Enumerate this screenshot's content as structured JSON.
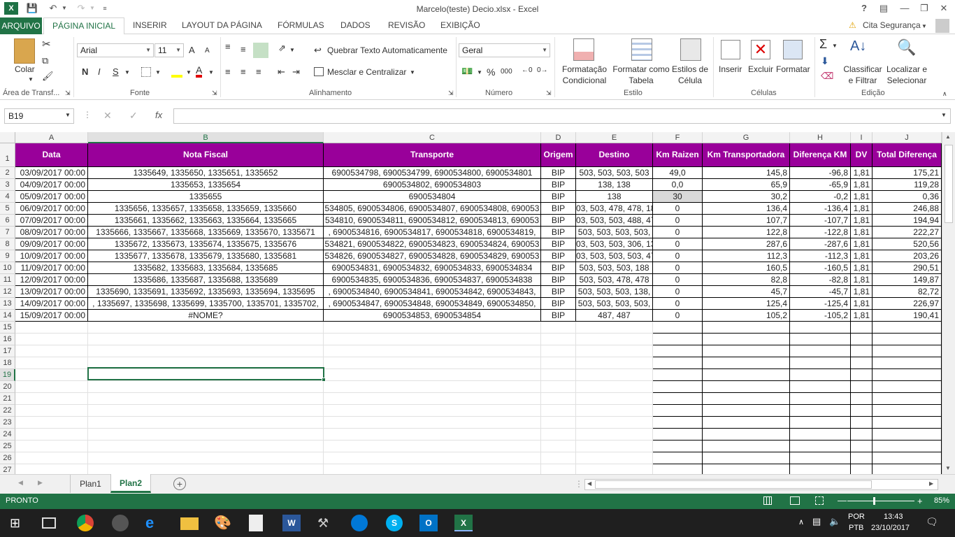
{
  "window": {
    "title": "Marcelo(teste) Decio.xlsx - Excel"
  },
  "ribbon_tabs": [
    {
      "label": "ARQUIVO"
    },
    {
      "label": "PÁGINA INICIAL"
    },
    {
      "label": "INSERIR"
    },
    {
      "label": "LAYOUT DA PÁGINA"
    },
    {
      "label": "FÓRMULAS"
    },
    {
      "label": "DADOS"
    },
    {
      "label": "REVISÃO"
    },
    {
      "label": "EXIBIÇÃO"
    }
  ],
  "account": {
    "label": "Cita Segurança"
  },
  "help": "?",
  "ribbon": {
    "clipboard": {
      "paste": "Colar",
      "group": "Área de Transf..."
    },
    "font": {
      "name": "Arial",
      "size": "11",
      "bold": "N",
      "italic": "I",
      "underline": "S",
      "grow": "A",
      "shrink": "A",
      "group": "Fonte"
    },
    "alignment": {
      "wrap": "Quebrar Texto Automaticamente",
      "merge": "Mesclar e Centralizar",
      "group": "Alinhamento"
    },
    "number": {
      "format": "Geral",
      "percent": "%",
      "thousands": "000",
      "group": "Número"
    },
    "styles": {
      "conditional": "Formatação Condicional",
      "table": "Formatar como Tabela",
      "cell": "Estilos de Célula",
      "group": "Estilo"
    },
    "cells": {
      "insert": "Inserir",
      "delete": "Excluir",
      "format": "Formatar",
      "group": "Células"
    },
    "editing": {
      "sort": "Classificar e Filtrar",
      "find": "Localizar e Selecionar",
      "group": "Edição"
    }
  },
  "formula_bar": {
    "name_box": "B19",
    "fx": "fx",
    "cancel": "✕",
    "enter": "✓"
  },
  "columns": [
    "A",
    "B",
    "C",
    "D",
    "E",
    "F",
    "G",
    "H",
    "I",
    "J"
  ],
  "header_row": [
    "Data",
    "Nota Fiscal",
    "Transporte",
    "Origem",
    "Destino",
    "Km Raizen",
    "Km Transportadora",
    "Diferença KM",
    "DV",
    "Total Diferença"
  ],
  "rows": [
    [
      "03/09/2017 00:00",
      "1335649, 1335650, 1335651, 1335652",
      "6900534798, 6900534799, 6900534800, 6900534801",
      "BIP",
      "503, 503, 503, 503",
      "49,0",
      "145,8",
      "-96,8",
      "1,81",
      "175,21"
    ],
    [
      "04/09/2017 00:00",
      "1335653, 1335654",
      "6900534802, 6900534803",
      "BIP",
      "138, 138",
      "0,0",
      "65,9",
      "-65,9",
      "1,81",
      "119,28"
    ],
    [
      "05/09/2017 00:00",
      "1335655",
      "6900534804",
      "BIP",
      "138",
      "30",
      "30,2",
      "-0,2",
      "1,81",
      "0,36"
    ],
    [
      "06/09/2017 00:00",
      "1335656, 1335657, 1335658, 1335659, 1335660",
      "534805, 6900534806, 6900534807, 6900534808, 690053",
      "BIP",
      "03, 503, 478, 478, 18",
      "0",
      "136,4",
      "-136,4",
      "1,81",
      "246,88"
    ],
    [
      "07/09/2017 00:00",
      "1335661, 1335662, 1335663, 1335664, 1335665",
      "534810, 6900534811, 6900534812, 6900534813, 690053",
      "BIP",
      "03, 503, 503, 488, 47",
      "0",
      "107,7",
      "-107,7",
      "1,81",
      "194,94"
    ],
    [
      "08/09/2017 00:00",
      "1335666, 1335667, 1335668, 1335669, 1335670, 1335671",
      ", 6900534816, 6900534817, 6900534818, 6900534819,",
      "BIP",
      "503, 503, 503, 503,",
      "0",
      "122,8",
      "-122,8",
      "1,81",
      "222,27"
    ],
    [
      "09/09/2017 00:00",
      "1335672, 1335673, 1335674, 1335675, 1335676",
      "534821, 6900534822, 6900534823, 6900534824, 690053",
      "BIP",
      "03, 503, 503, 306, 13",
      "0",
      "287,6",
      "-287,6",
      "1,81",
      "520,56"
    ],
    [
      "10/09/2017 00:00",
      "1335677, 1335678, 1335679, 1335680, 1335681",
      "534826, 6900534827, 6900534828, 6900534829, 690053",
      "BIP",
      "03, 503, 503, 503, 47",
      "0",
      "112,3",
      "-112,3",
      "1,81",
      "203,26"
    ],
    [
      "11/09/2017 00:00",
      "1335682, 1335683, 1335684, 1335685",
      "6900534831, 6900534832, 6900534833, 6900534834",
      "BIP",
      "503, 503, 503, 188",
      "0",
      "160,5",
      "-160,5",
      "1,81",
      "290,51"
    ],
    [
      "12/09/2017 00:00",
      "1335686, 1335687, 1335688, 1335689",
      "6900534835, 6900534836, 6900534837, 6900534838",
      "BIP",
      "503, 503, 478, 478",
      "0",
      "82,8",
      "-82,8",
      "1,81",
      "149,87"
    ],
    [
      "13/09/2017 00:00",
      "1335690, 1335691, 1335692, 1335693, 1335694, 1335695",
      ", 6900534840, 6900534841, 6900534842, 6900534843,",
      "BIP",
      "503, 503, 503, 138,",
      "0",
      "45,7",
      "-45,7",
      "1,81",
      "82,72"
    ],
    [
      "14/09/2017 00:00",
      ", 1335697, 1335698, 1335699, 1335700, 1335701, 1335702,",
      ", 6900534847, 6900534848, 6900534849, 6900534850,",
      "BIP",
      "503, 503, 503, 503,",
      "0",
      "125,4",
      "-125,4",
      "1,81",
      "226,97"
    ],
    [
      "15/09/2017 00:00",
      "#NOME?",
      "6900534853, 6900534854",
      "BIP",
      "487, 487",
      "0",
      "105,2",
      "-105,2",
      "1,81",
      "190,41"
    ]
  ],
  "row_numbers": [
    "1",
    "2",
    "3",
    "4",
    "5",
    "6",
    "7",
    "8",
    "9",
    "10",
    "11",
    "12",
    "13",
    "14",
    "15",
    "16",
    "17",
    "18",
    "19",
    "20",
    "21",
    "22",
    "23",
    "24",
    "25",
    "26",
    "27"
  ],
  "sheets": [
    {
      "label": "Plan1"
    },
    {
      "label": "Plan2"
    }
  ],
  "active_sheet": "Plan2",
  "status": {
    "mode": "PRONTO",
    "zoom": "85%"
  },
  "taskbar": {
    "lang1": "POR",
    "lang2": "PTB",
    "time": "13:43",
    "date": "23/10/2017"
  },
  "colors": {
    "excel_green": "#217346",
    "header_fill": "#99009a"
  }
}
